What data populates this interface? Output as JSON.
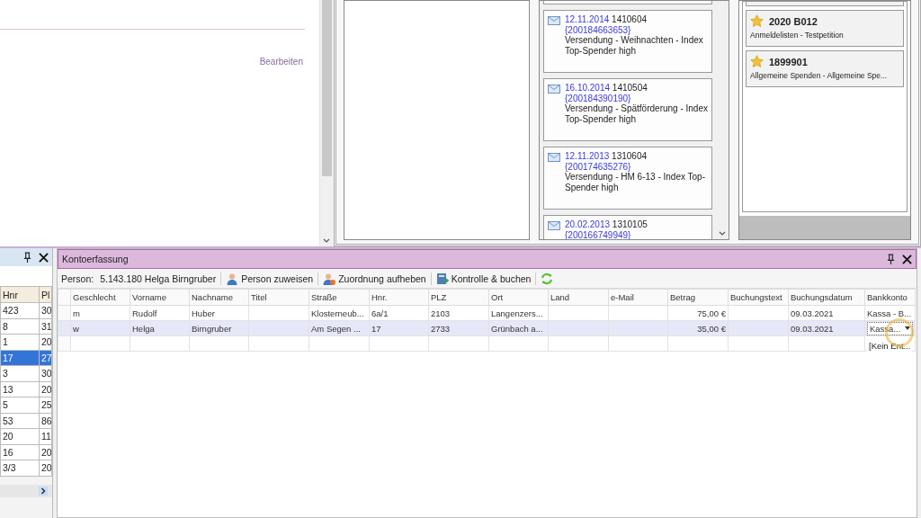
{
  "details_panel": {
    "link": "Bearbeiten"
  },
  "mailings": [
    {
      "date": "12.11.2014",
      "code": "1410604",
      "id": "{200184663653}",
      "text": "Versendung - Weihnachten - Index Top-Spender high"
    },
    {
      "date": "16.10.2014",
      "code": "1410504",
      "id": "{200184390190}",
      "text": "Versendung - Spätförderung - Index Top-Spender high"
    },
    {
      "date": "12.11.2013",
      "code": "1310604",
      "id": "{200174635276}",
      "text": "Versendung - HM 6-13 - Index Top-Spender high"
    },
    {
      "date": "20.02.2013",
      "code": "1310105",
      "id": "{200166749949}"
    }
  ],
  "campaigns": [
    {
      "code": "2020 B012",
      "text": "Anmeldelisten - Testpetition"
    },
    {
      "code": "1899901",
      "text": "Allgemeine Spenden - Allgemeine Spe..."
    }
  ],
  "address_panel": {
    "columns": [
      "Hnr",
      "Pl"
    ],
    "rows": [
      {
        "cells": [
          "423",
          "30"
        ],
        "selected": false
      },
      {
        "cells": [
          "8",
          "31"
        ],
        "selected": false
      },
      {
        "cells": [
          "1",
          "20"
        ],
        "selected": false
      },
      {
        "cells": [
          "17",
          "27"
        ],
        "selected": true
      },
      {
        "cells": [
          "3",
          "30"
        ],
        "selected": false
      },
      {
        "cells": [
          "13",
          "20"
        ],
        "selected": false
      },
      {
        "cells": [
          "5",
          "25"
        ],
        "selected": false
      },
      {
        "cells": [
          "53",
          "86"
        ],
        "selected": false
      },
      {
        "cells": [
          "20",
          "11"
        ],
        "selected": false
      },
      {
        "cells": [
          "16",
          "20"
        ],
        "selected": false
      },
      {
        "cells": [
          "3/3",
          "20"
        ],
        "selected": false
      }
    ]
  },
  "kontoerfassung": {
    "title": "Kontoerfassung",
    "person_label": "Person:",
    "person_value": "5.143.180 Helga Birngruber",
    "toolbar": [
      {
        "kind": "assign",
        "label": "Person zuweisen"
      },
      {
        "kind": "unassign",
        "label": "Zuordnung aufheben"
      },
      {
        "kind": "book",
        "label": "Kontrolle & buchen"
      },
      {
        "kind": "refresh"
      }
    ],
    "columns": [
      "Geschlecht",
      "Vorname",
      "Nachname",
      "Titel",
      "Straße",
      "Hnr.",
      "PLZ",
      "Ort",
      "Land",
      "e-Mail",
      "Betrag",
      "Buchungstext",
      "Buchungsdatum",
      "Bankkonto"
    ],
    "rows": [
      {
        "cells": [
          "m",
          "Rudolf",
          "Huber",
          "",
          "Klosterneub...",
          "6a/1",
          "2103",
          "Langenzers...",
          "",
          "",
          "75,00 €",
          "",
          "09.03.2021",
          "Kassa - B..."
        ],
        "selected": false,
        "editing": false
      },
      {
        "cells": [
          "w",
          "Helga",
          "Birngruber",
          "",
          "Am Segen ...",
          "17",
          "2733",
          "Grünbach a...",
          "",
          "",
          "35,00 €",
          "",
          "09.03.2021",
          "Kassa..."
        ],
        "selected": true,
        "editing": true
      },
      {
        "cells": [
          "",
          "",
          "",
          "",
          "",
          "",
          "",
          "",
          "",
          "",
          "",
          "",
          "",
          ""
        ],
        "selected": false,
        "editing": false
      }
    ],
    "dropdown_option": "[Kein Ent..."
  }
}
